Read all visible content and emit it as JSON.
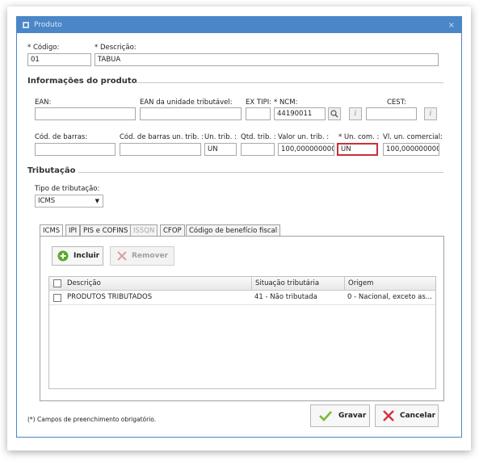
{
  "window": {
    "title": "Produto",
    "close": "×"
  },
  "fields": {
    "codigo": {
      "label": "* Código:",
      "value": "01"
    },
    "descricao": {
      "label": "* Descrição:",
      "value": "TABUA"
    },
    "ean": {
      "label": "EAN:",
      "value": ""
    },
    "ean_trib": {
      "label": "EAN da unidade tributável:",
      "value": ""
    },
    "ex_tipi": {
      "label": "EX TIPI:",
      "value": ""
    },
    "ncm": {
      "label": "* NCM:",
      "value": "44190011"
    },
    "cest": {
      "label": "CEST:",
      "value": ""
    },
    "cod_barras": {
      "label": "Cód. de barras:",
      "value": ""
    },
    "cod_barras_trib": {
      "label": "Cód. de barras un. trib. :",
      "value": ""
    },
    "un_trib": {
      "label": "Un. trib. :",
      "value": "UN"
    },
    "qtd_trib": {
      "label": "Qtd. trib. :",
      "value": ""
    },
    "valor_un_trib": {
      "label": "Valor un. trib. :",
      "value": "100,0000000000"
    },
    "un_com": {
      "label": "* Un. com. :",
      "value": "UN"
    },
    "vl_un_com": {
      "label": "Vl. un. comercial:",
      "value": "100,0000000000"
    }
  },
  "sections": {
    "info": "Informações do produto",
    "tributacao": "Tributação"
  },
  "tipo_tributacao": {
    "label": "Tipo de tributação:",
    "value": "ICMS"
  },
  "tabs": [
    "ICMS",
    "IPI",
    "PIS e COFINS",
    "ISSQN",
    "CFOP",
    "Código de benefício fiscal"
  ],
  "toolbar": {
    "incluir": "Incluir",
    "remover": "Remover"
  },
  "grid": {
    "headers": [
      "Descrição",
      "Situação tributária",
      "Origem"
    ],
    "rows": [
      [
        "PRODUTOS TRIBUTADOS",
        "41 - Não tributada",
        "0 - Nacional, exceto as..."
      ]
    ]
  },
  "footer": {
    "note": "(*) Campos de preenchimento obrigatório.",
    "gravar": "Gravar",
    "cancelar": "Cancelar"
  },
  "colors": {
    "titlebar": "#4a86c8",
    "error_border": "#c8303a",
    "gravar_check": "#7ab83a",
    "cancelar_x": "#d0343a",
    "incluir_plus": "#5aa82a"
  }
}
